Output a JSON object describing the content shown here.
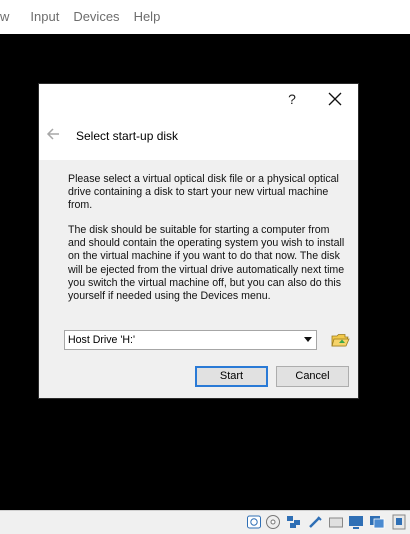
{
  "menubar": {
    "items": [
      "w",
      "Input",
      "Devices",
      "Help"
    ]
  },
  "dialog": {
    "help_label": "?",
    "title": "Select start-up disk",
    "paragraph1": "Please select a virtual optical disk file or a physical optical drive containing a disk to start your new virtual machine from.",
    "paragraph2": "The disk should be suitable for starting a computer from and should contain the operating system you wish to install on the virtual machine if you want to do that now. The disk will be ejected from the virtual drive automatically next time you switch the virtual machine off, but you can also do this yourself if needed using the Devices menu.",
    "disk_select": {
      "value": "Host Drive 'H:'"
    },
    "start_label": "Start",
    "cancel_label": "Cancel"
  },
  "statusbar": {
    "icons": [
      "hard-disk-icon",
      "optical-disk-icon",
      "network-icon",
      "usb-icon",
      "shared-folder-icon",
      "display-icon",
      "capture-icon",
      "recording-icon"
    ]
  },
  "colors": {
    "default_button_border": "#2a7ad6",
    "dialog_bg": "#f0f0f0",
    "vm_screen": "#000000"
  }
}
